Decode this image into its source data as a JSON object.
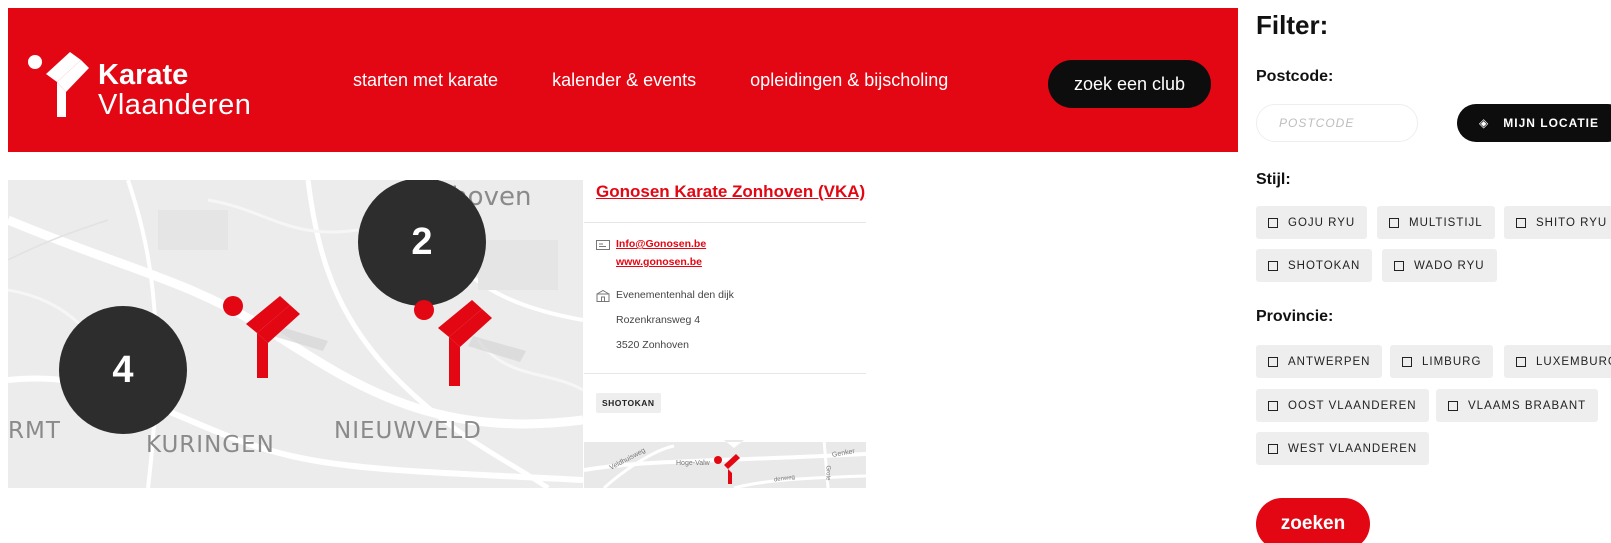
{
  "header": {
    "logo": {
      "line1": "Karate",
      "line2": "Vlaanderen"
    },
    "nav": [
      "starten met karate",
      "kalender & events",
      "opleidingen & bijscholing"
    ],
    "cta": "zoek een club",
    "brand_color": "#e30613"
  },
  "map": {
    "labels": {
      "zonhoven": "Zonhoven",
      "nieuwveld": "NIEUWVELD",
      "kuringen": "KURINGEN",
      "rmt": "RMT"
    },
    "clusters": [
      "2",
      "4"
    ],
    "marker_icon": "karate-logo-marker-icon"
  },
  "club_card": {
    "title": "Gonosen Karate Zonhoven (VKA)",
    "email": "Info@Gonosen.be",
    "website": "www.gonosen.be",
    "venue": "Evenementenhal den dijk",
    "street": "Rozenkransweg 4",
    "city": "3520 Zonhoven",
    "style_tag": "SHOTOKAN",
    "mini_map": {
      "street1": "Veldhuisweg",
      "street2": "Hoge-Valw",
      "street3": "Genker",
      "street4": "Grote",
      "street5": "denweg"
    }
  },
  "filter": {
    "title": "Filter:",
    "postcode_label": "Postcode:",
    "postcode_placeholder": "POSTCODE",
    "location_button": "MIJN LOCATIE",
    "style_label": "Stijl:",
    "styles": [
      "GOJU RYU",
      "MULTISTIJL",
      "SHITO RYU",
      "SHOTOKAN",
      "WADO RYU"
    ],
    "province_label": "Provincie:",
    "provinces": [
      "ANTWERPEN",
      "LIMBURG",
      "LUXEMBURG",
      "OOST VLAANDEREN",
      "VLAAMS BRABANT",
      "WEST VLAANDEREN"
    ],
    "search_button": "zoeken"
  }
}
